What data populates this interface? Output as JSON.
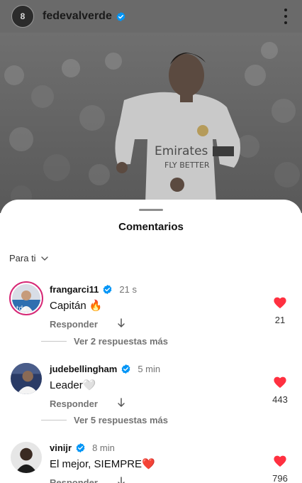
{
  "post": {
    "username": "fedevalverde",
    "avatar_text": "8",
    "more_icon": "more-vertical-icon",
    "photo_caption_text": "Emirates FLY BETTER"
  },
  "sheet": {
    "title": "Comentarios",
    "sort_label": "Para ti"
  },
  "comments": [
    {
      "username": "frangarci11",
      "time": "21 s",
      "text": "Capitán 🔥",
      "reply_label": "Responder",
      "like_count": "21",
      "more_replies": "Ver 2 respuestas más"
    },
    {
      "username": "judebellingham",
      "time": "5 min",
      "text": "Leader🤍",
      "reply_label": "Responder",
      "like_count": "443",
      "more_replies": "Ver 5 respuestas más"
    },
    {
      "username": "vinijr",
      "time": "8 min",
      "text": "El mejor, SIEMPRE❤️",
      "reply_label": "Responder",
      "like_count": "796"
    }
  ],
  "colors": {
    "verified": "#0095f6",
    "like": "#ff3040",
    "muted": "#737373",
    "story_ring": "#d62976"
  }
}
